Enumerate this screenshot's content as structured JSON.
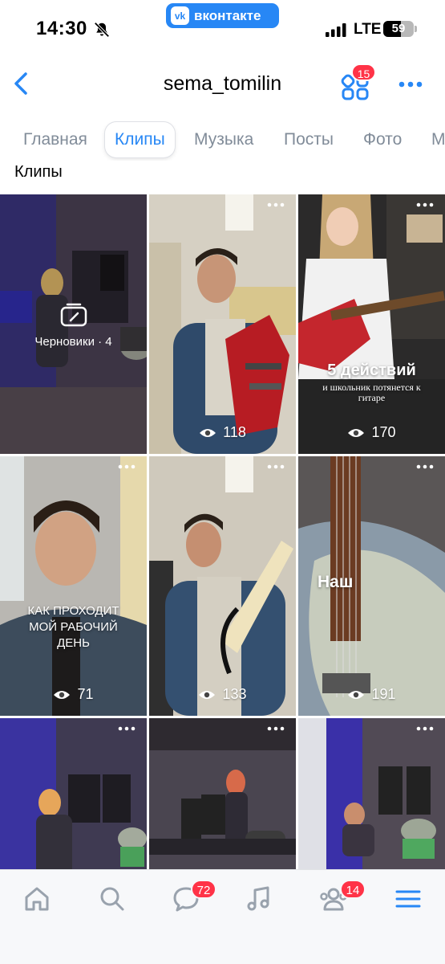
{
  "status_bar": {
    "time": "14:30",
    "app_pill": "вконтакте",
    "app_logo": "vk",
    "network": "LTE",
    "battery_percent": "59",
    "battery_level": 0.59
  },
  "header": {
    "title": "sema_tomilin",
    "services_badge": "15"
  },
  "tabs": [
    {
      "label": "Главная",
      "active": false
    },
    {
      "label": "Клипы",
      "active": true
    },
    {
      "label": "Музыка",
      "active": false
    },
    {
      "label": "Посты",
      "active": false
    },
    {
      "label": "Фото",
      "active": false
    },
    {
      "label": "М",
      "active": false
    }
  ],
  "section_title": "Клипы",
  "clips": [
    {
      "drafts_label": "Черновики · 4"
    },
    {
      "views": "118"
    },
    {
      "views": "170",
      "caption_main": "5 действий",
      "caption_sub": "и школьник потянется к гитаре"
    },
    {
      "views": "71",
      "caption_main": "КАК ПРОХОДИТ МОЙ РАБОЧИЙ ДЕНЬ"
    },
    {
      "views": "133"
    },
    {
      "views": "191",
      "caption_main": "Наш"
    },
    {},
    {},
    {}
  ],
  "bottom_nav": {
    "messages_badge": "72",
    "friends_badge": "14"
  },
  "colors": {
    "accent": "#2787f5",
    "badge": "#ff3347",
    "inactive_tab": "#818c99"
  }
}
